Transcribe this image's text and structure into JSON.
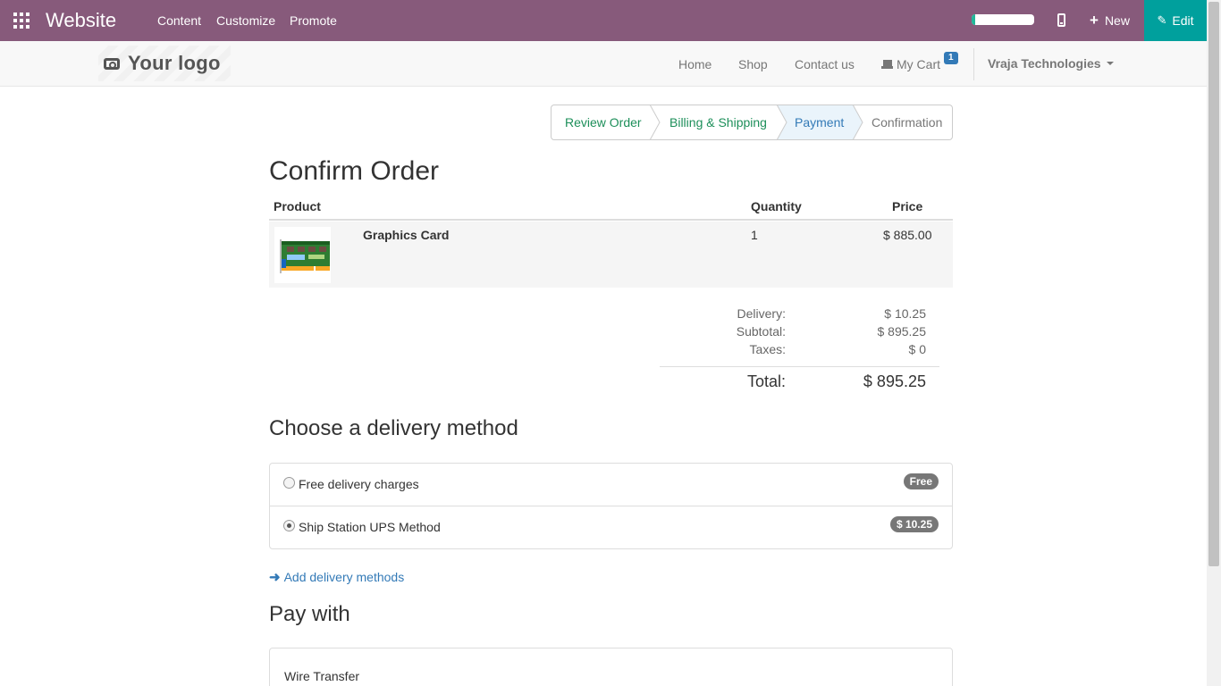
{
  "topbar": {
    "brand": "Website",
    "menu": [
      "Content",
      "Customize",
      "Promote"
    ],
    "progress": 0.05,
    "new_label": "New",
    "edit_label": "Edit",
    "bg_color": "#875a7b",
    "edit_color": "#00a09d"
  },
  "navbar": {
    "logo_text": "Your logo",
    "links": [
      "Home",
      "Shop",
      "Contact us"
    ],
    "cart_label": "My Cart",
    "cart_count": "1",
    "company": "Vraja Technologies"
  },
  "wizard": {
    "steps": [
      {
        "label": "Review Order",
        "state": "done"
      },
      {
        "label": "Billing & Shipping",
        "state": "done"
      },
      {
        "label": "Payment",
        "state": "active"
      },
      {
        "label": "Confirmation",
        "state": "todo"
      }
    ]
  },
  "order": {
    "title": "Confirm Order",
    "headers": {
      "product": "Product",
      "quantity": "Quantity",
      "price": "Price"
    },
    "items": [
      {
        "name": "Graphics Card",
        "quantity": "1",
        "price": "$ 885.00"
      }
    ],
    "totals": {
      "delivery_label": "Delivery:",
      "delivery": "$ 10.25",
      "subtotal_label": "Subtotal:",
      "subtotal": "$ 895.25",
      "taxes_label": "Taxes:",
      "taxes": "$ 0",
      "total_label": "Total:",
      "total": "$ 895.25"
    }
  },
  "delivery": {
    "title": "Choose a delivery method",
    "options": [
      {
        "label": "Free delivery charges",
        "badge": "Free",
        "selected": false
      },
      {
        "label": "Ship Station UPS Method",
        "badge": "$ 10.25",
        "selected": true
      }
    ],
    "add_link": "Add delivery methods"
  },
  "payment": {
    "title": "Pay with",
    "methods": [
      "Wire Transfer"
    ]
  }
}
